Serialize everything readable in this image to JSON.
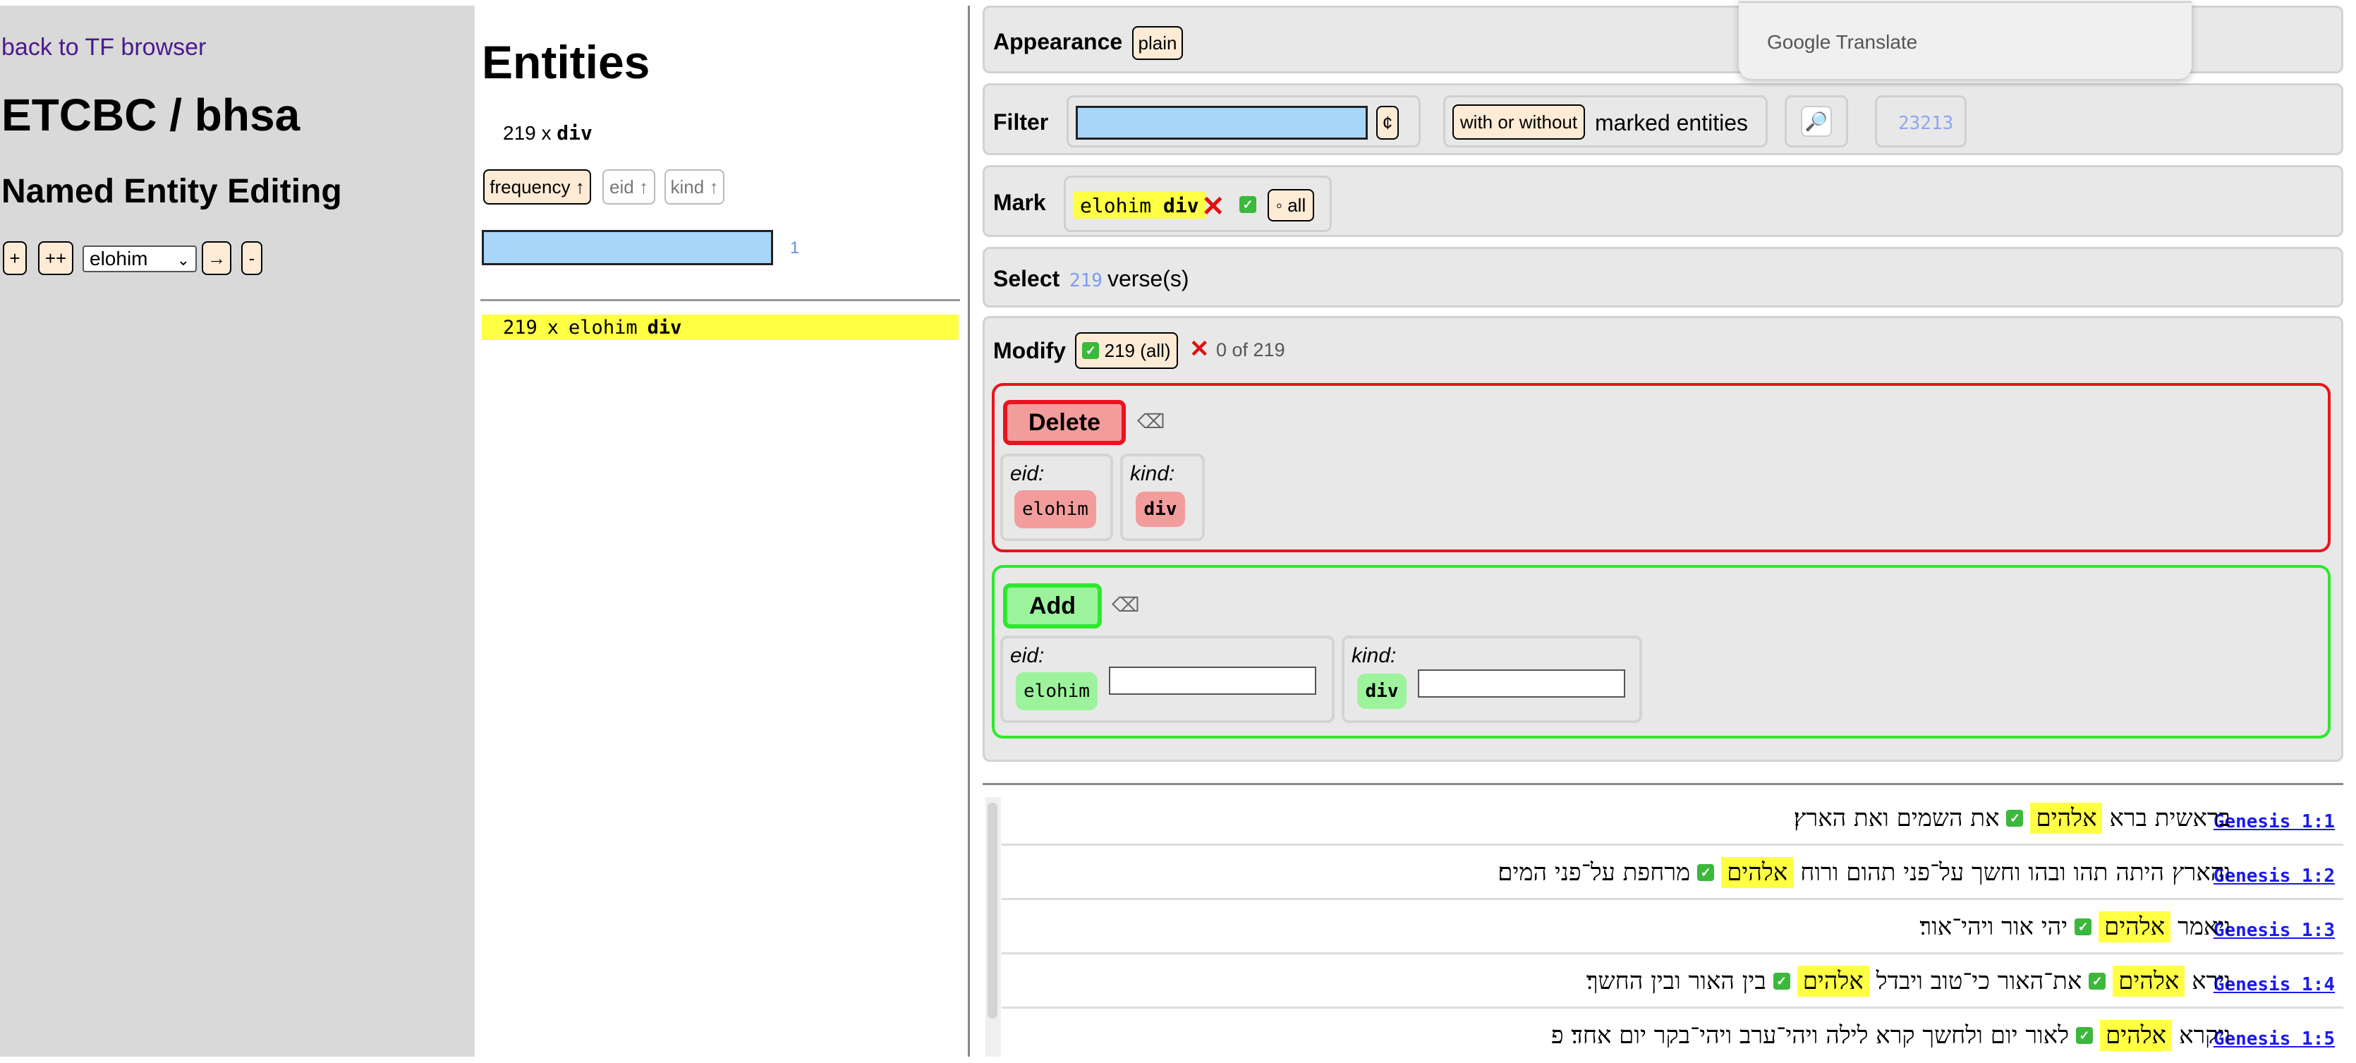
{
  "sidebar": {
    "back_link": "back to TF browser",
    "title": "ETCBC / bhsa",
    "subtitle": "Named Entity Editing",
    "btn_plus": "+",
    "btn_plusplus": "++",
    "select_value": "elohim",
    "btn_arrow": "→",
    "btn_minus": "-"
  },
  "entities": {
    "title": "Entities",
    "summary_count": "219",
    "summary_x": "x",
    "summary_kind": "div",
    "sort_frequency": "frequency ↑",
    "sort_eid": "eid ↑",
    "sort_kind": "kind ↑",
    "filter_count": "1",
    "row": {
      "count": "219",
      "x": "x",
      "eid": "elohim",
      "kind": "div"
    }
  },
  "google_translate": {
    "label": "Google Translate"
  },
  "appearance": {
    "label": "Appearance",
    "value": "plain"
  },
  "filter": {
    "label": "Filter",
    "cent_button": "¢",
    "with_without": "with or without",
    "marked_text": "marked entities",
    "count": "23213"
  },
  "mark": {
    "label": "Mark",
    "eid": "elohim",
    "kind": "div",
    "all_label": "◦ all"
  },
  "select": {
    "label": "Select",
    "count": "219",
    "suffix": "verse(s)"
  },
  "modify": {
    "label": "Modify",
    "all_label": "219 (all)",
    "none_label": "0 of 219"
  },
  "delete": {
    "button": "Delete",
    "eid_label": "eid:",
    "eid_value": "elohim",
    "kind_label": "kind:",
    "kind_value": "div"
  },
  "add": {
    "button": "Add",
    "eid_label": "eid:",
    "eid_value": "elohim",
    "kind_label": "kind:",
    "kind_value": "div"
  },
  "verses": [
    {
      "ref": "Genesis 1:1",
      "before": "בראשית ברא",
      "highlight": "אלהים",
      "after": "את השמים ואת הארץ׃"
    },
    {
      "ref": "Genesis 1:2",
      "before": "והארץ היתה תהו ובהו וחשך על־פני תהום ורוח",
      "highlight": "אלהים",
      "after": "מרחפת על־פני המים׃"
    },
    {
      "ref": "Genesis 1:3",
      "before": "ויאמר",
      "highlight": "אלהים",
      "after": "יהי אור ויהי־אור׃"
    },
    {
      "ref": "Genesis 1:4",
      "before": "וירא",
      "highlight": "אלהים",
      "after": "את־האור כי־טוב ויבדל",
      "highlight2": "אלהים",
      "after2": "בין האור ובין החשך׃"
    },
    {
      "ref": "Genesis 1:5",
      "before": "ויקרא",
      "highlight": "אלהים",
      "after": "לאור יום ולחשך קרא לילה ויהי־ערב ויהי־בקר יום אחד׃ פ"
    }
  ]
}
